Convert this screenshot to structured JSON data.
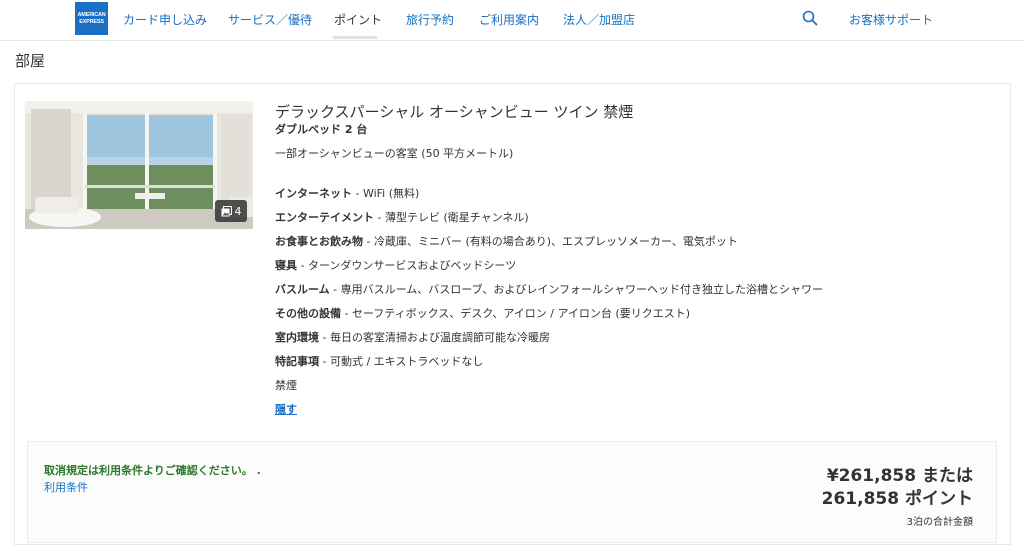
{
  "brand": {
    "logo_line1": "AMERICAN",
    "logo_line2": "EXPRESS",
    "color": "#1a6fc4"
  },
  "nav": {
    "items": [
      {
        "label": "カード申し込み",
        "active": false
      },
      {
        "label": "サービス／優待",
        "active": false
      },
      {
        "label": "ポイント",
        "active": true
      },
      {
        "label": "旅行予約",
        "active": false
      },
      {
        "label": "ご利用案内",
        "active": false
      },
      {
        "label": "法人／加盟店",
        "active": false
      }
    ],
    "support_label": "お客様サポート",
    "search_icon": "search-icon"
  },
  "section_title": "部屋",
  "room": {
    "name": "デラックスパーシャル オーシャンビュー ツイン 禁煙",
    "bed": "ダブルベッド 2 台",
    "description": "一部オーシャンビューの客室 (50 平方メートル)",
    "photo_count": "4",
    "amenities": [
      {
        "label": "インターネット",
        "value": " - WiFi (無料)"
      },
      {
        "label": "エンターテイメント",
        "value": " - 薄型テレビ (衛星チャンネル)"
      },
      {
        "label": "お食事とお飲み物",
        "value": " - 冷蔵庫、ミニバー (有料の場合あり)、エスプレッソメーカー、電気ポット"
      },
      {
        "label": "寝具",
        "value": " - ターンダウンサービスおよびベッドシーツ"
      },
      {
        "label": "バスルーム",
        "value": " - 専用バスルーム、バスローブ、およびレインフォールシャワーヘッド付き独立した浴槽とシャワー"
      },
      {
        "label": "その他の設備",
        "value": " - セーフティボックス、デスク、アイロン / アイロン台 (要リクエスト)"
      },
      {
        "label": "室内環境",
        "value": " - 毎日の客室清掃および温度調節可能な冷暖房"
      },
      {
        "label": "特記事項",
        "value": " - 可動式 / エキストラベッドなし"
      },
      {
        "label": "",
        "value": "禁煙"
      }
    ],
    "hide_label": "隠す"
  },
  "pricing": {
    "cancel_note": "取消規定は利用条件よりご確認ください。 .",
    "terms_link": "利用条件",
    "price_line1": "¥261,858 または",
    "price_line2": "261,858 ポイント",
    "price_sub": "3泊の合計金額"
  }
}
